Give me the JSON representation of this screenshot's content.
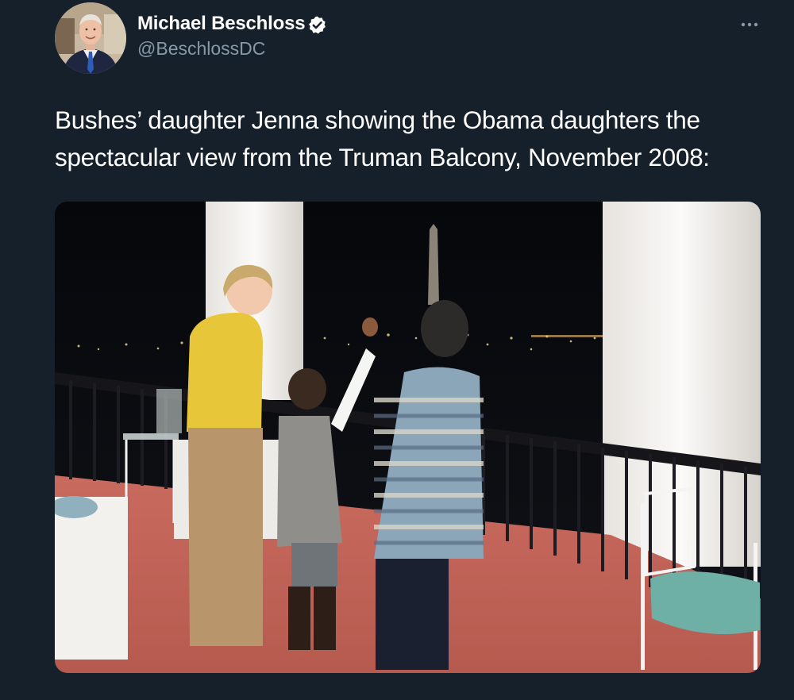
{
  "tweet": {
    "author": {
      "name": "Michael Beschloss",
      "handle": "@BeschlossDC",
      "verified": true,
      "avatar_icon": "profile-photo"
    },
    "text": "Bushes’ daughter Jenna showing the Obama daughters the spectacular view from the Truman Balcony, November 2008:",
    "more_icon": "more-horizontal-icon",
    "media": {
      "type": "photo",
      "icon": "photo"
    }
  },
  "colors": {
    "background": "#15202b",
    "text_primary": "#ffffff",
    "text_secondary": "#8899a6",
    "verified_badge": "#ffffff"
  }
}
